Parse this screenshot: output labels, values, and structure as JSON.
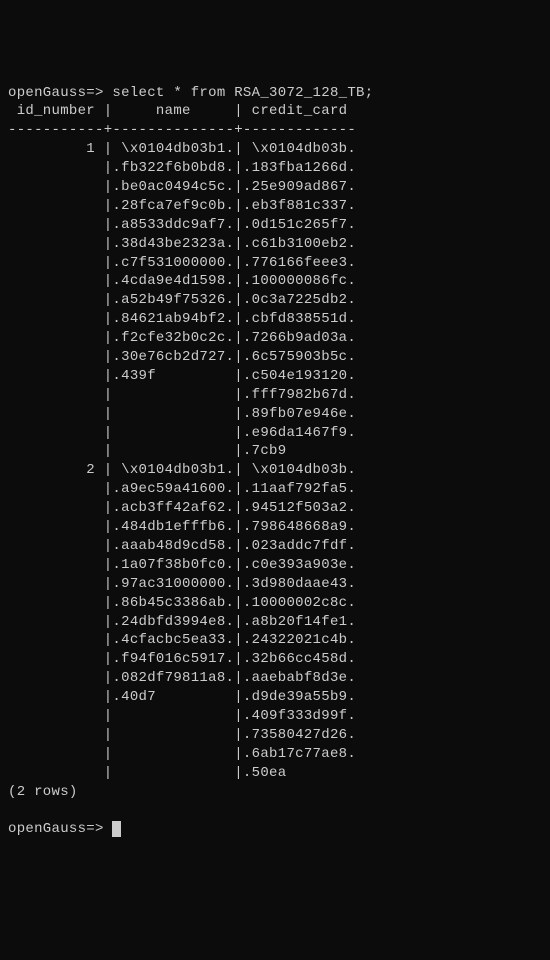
{
  "prompt1": "openGauss=> ",
  "query": "select * from RSA_3072_128_TB;",
  "headers": {
    "col1": " id_number ",
    "col2": "     name     ",
    "col3": " credit_card"
  },
  "separator": "-----------+--------------+-------------",
  "rows": [
    {
      "id": "         1 ",
      "name": " \\x0104db03b1.",
      "cc": " \\x0104db03b."
    },
    {
      "id": "           ",
      "name": ".fb322f6b0bd8.",
      "cc": ".183fba1266d."
    },
    {
      "id": "           ",
      "name": ".be0ac0494c5c.",
      "cc": ".25e909ad867."
    },
    {
      "id": "           ",
      "name": ".28fca7ef9c0b.",
      "cc": ".eb3f881c337."
    },
    {
      "id": "           ",
      "name": ".a8533ddc9af7.",
      "cc": ".0d151c265f7."
    },
    {
      "id": "           ",
      "name": ".38d43be2323a.",
      "cc": ".c61b3100eb2."
    },
    {
      "id": "           ",
      "name": ".c7f531000000.",
      "cc": ".776166feee3."
    },
    {
      "id": "           ",
      "name": ".4cda9e4d1598.",
      "cc": ".100000086fc."
    },
    {
      "id": "           ",
      "name": ".a52b49f75326.",
      "cc": ".0c3a7225db2."
    },
    {
      "id": "           ",
      "name": ".84621ab94bf2.",
      "cc": ".cbfd838551d."
    },
    {
      "id": "           ",
      "name": ".f2cfe32b0c2c.",
      "cc": ".7266b9ad03a."
    },
    {
      "id": "           ",
      "name": ".30e76cb2d727.",
      "cc": ".6c575903b5c."
    },
    {
      "id": "           ",
      "name": ".439f         ",
      "cc": ".c504e193120."
    },
    {
      "id": "           ",
      "name": "              ",
      "cc": ".fff7982b67d."
    },
    {
      "id": "           ",
      "name": "              ",
      "cc": ".89fb07e946e."
    },
    {
      "id": "           ",
      "name": "              ",
      "cc": ".e96da1467f9."
    },
    {
      "id": "           ",
      "name": "              ",
      "cc": ".7cb9"
    },
    {
      "id": "         2 ",
      "name": " \\x0104db03b1.",
      "cc": " \\x0104db03b."
    },
    {
      "id": "           ",
      "name": ".a9ec59a41600.",
      "cc": ".11aaf792fa5."
    },
    {
      "id": "           ",
      "name": ".acb3ff42af62.",
      "cc": ".94512f503a2."
    },
    {
      "id": "           ",
      "name": ".484db1efffb6.",
      "cc": ".798648668a9."
    },
    {
      "id": "           ",
      "name": ".aaab48d9cd58.",
      "cc": ".023addc7fdf."
    },
    {
      "id": "           ",
      "name": ".1a07f38b0fc0.",
      "cc": ".c0e393a903e."
    },
    {
      "id": "           ",
      "name": ".97ac31000000.",
      "cc": ".3d980daae43."
    },
    {
      "id": "           ",
      "name": ".86b45c3386ab.",
      "cc": ".10000002c8c."
    },
    {
      "id": "           ",
      "name": ".24dbfd3994e8.",
      "cc": ".a8b20f14fe1."
    },
    {
      "id": "           ",
      "name": ".4cfacbc5ea33.",
      "cc": ".24322021c4b."
    },
    {
      "id": "           ",
      "name": ".f94f016c5917.",
      "cc": ".32b66cc458d."
    },
    {
      "id": "           ",
      "name": ".082df79811a8.",
      "cc": ".aaebabf8d3e."
    },
    {
      "id": "           ",
      "name": ".40d7         ",
      "cc": ".d9de39a55b9."
    },
    {
      "id": "           ",
      "name": "              ",
      "cc": ".409f333d99f."
    },
    {
      "id": "           ",
      "name": "              ",
      "cc": ".73580427d26."
    },
    {
      "id": "           ",
      "name": "              ",
      "cc": ".6ab17c77ae8."
    },
    {
      "id": "           ",
      "name": "              ",
      "cc": ".50ea"
    }
  ],
  "rowcount": "(2 rows)",
  "prompt2": "openGauss=> "
}
